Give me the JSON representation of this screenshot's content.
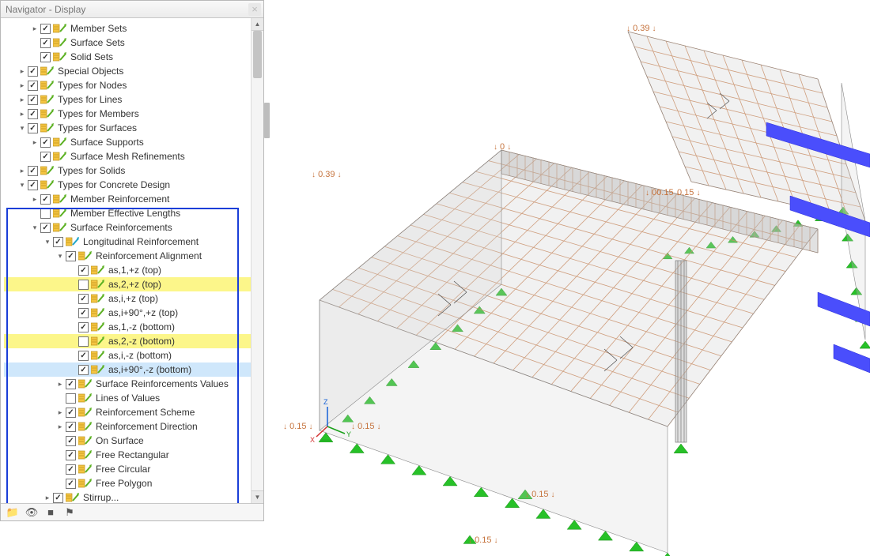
{
  "panel": {
    "title": "Navigator - Display"
  },
  "tree": [
    {
      "indent": 2,
      "expander": ">",
      "checked": true,
      "label": "Member Sets"
    },
    {
      "indent": 2,
      "expander": "",
      "checked": true,
      "label": "Surface Sets"
    },
    {
      "indent": 2,
      "expander": "",
      "checked": true,
      "label": "Solid Sets"
    },
    {
      "indent": 1,
      "expander": ">",
      "checked": true,
      "label": "Special Objects"
    },
    {
      "indent": 1,
      "expander": ">",
      "checked": true,
      "label": "Types for Nodes"
    },
    {
      "indent": 1,
      "expander": ">",
      "checked": true,
      "label": "Types for Lines"
    },
    {
      "indent": 1,
      "expander": ">",
      "checked": true,
      "label": "Types for Members"
    },
    {
      "indent": 1,
      "expander": "v",
      "checked": true,
      "label": "Types for Surfaces"
    },
    {
      "indent": 2,
      "expander": ">",
      "checked": true,
      "label": "Surface Supports"
    },
    {
      "indent": 2,
      "expander": "",
      "checked": true,
      "label": "Surface Mesh Refinements"
    },
    {
      "indent": 1,
      "expander": ">",
      "checked": true,
      "label": "Types for Solids"
    },
    {
      "indent": 1,
      "expander": "v",
      "checked": true,
      "label": "Types for Concrete Design"
    },
    {
      "indent": 2,
      "expander": ">",
      "checked": true,
      "label": "Member Reinforcement"
    },
    {
      "indent": 2,
      "expander": "",
      "checked": false,
      "label": "Member Effective Lengths"
    },
    {
      "indent": 2,
      "expander": "v",
      "checked": true,
      "label": "Surface Reinforcements"
    },
    {
      "indent": 3,
      "expander": "v",
      "checked": true,
      "label": "Longitudinal Reinforcement",
      "icon2": true
    },
    {
      "indent": 4,
      "expander": "v",
      "checked": true,
      "label": "Reinforcement Alignment"
    },
    {
      "indent": 5,
      "expander": "",
      "checked": true,
      "label": "as,1,+z (top)"
    },
    {
      "indent": 5,
      "expander": "",
      "checked": false,
      "label": "as,2,+z (top)",
      "hl": true
    },
    {
      "indent": 5,
      "expander": "",
      "checked": true,
      "label": "as,i,+z (top)"
    },
    {
      "indent": 5,
      "expander": "",
      "checked": true,
      "label": "as,i+90°,+z (top)"
    },
    {
      "indent": 5,
      "expander": "",
      "checked": true,
      "label": "as,1,-z (bottom)"
    },
    {
      "indent": 5,
      "expander": "",
      "checked": false,
      "label": "as,2,-z (bottom)",
      "hl": true
    },
    {
      "indent": 5,
      "expander": "",
      "checked": true,
      "label": "as,i,-z (bottom)"
    },
    {
      "indent": 5,
      "expander": "",
      "checked": true,
      "label": "as,i+90°,-z (bottom)",
      "selected": true
    },
    {
      "indent": 4,
      "expander": ">",
      "checked": true,
      "label": "Surface Reinforcements Values"
    },
    {
      "indent": 4,
      "expander": "",
      "checked": false,
      "label": "Lines of Values"
    },
    {
      "indent": 4,
      "expander": ">",
      "checked": true,
      "label": "Reinforcement Scheme"
    },
    {
      "indent": 4,
      "expander": ">",
      "checked": true,
      "label": "Reinforcement Direction"
    },
    {
      "indent": 4,
      "expander": "",
      "checked": true,
      "label": "On Surface"
    },
    {
      "indent": 4,
      "expander": "",
      "checked": true,
      "label": "Free Rectangular"
    },
    {
      "indent": 4,
      "expander": "",
      "checked": true,
      "label": "Free Circular"
    },
    {
      "indent": 4,
      "expander": "",
      "checked": true,
      "label": "Free Polygon"
    },
    {
      "indent": 3,
      "expander": ">",
      "checked": true,
      "label": "Stirrup..."
    }
  ],
  "dims": {
    "d1": "0.39",
    "d2": "0.39",
    "d3": "0.15",
    "d4": "0.15",
    "d5": "0.15",
    "d6": "0.15",
    "d7": "0.15",
    "d8": "0.15",
    "d9": "0.15"
  }
}
